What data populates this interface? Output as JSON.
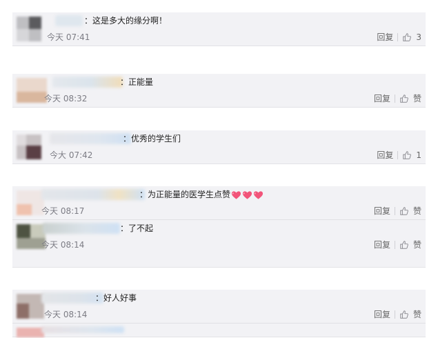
{
  "comments": [
    {
      "rows": [
        {
          "text": "：这是多大的缘分啊！",
          "time": "今天 07:41",
          "reply": "回复",
          "like": "3",
          "hearts": 0
        }
      ]
    },
    {
      "rows": [
        {
          "text": "：正能量",
          "time": "今天 08:32",
          "reply": "回复",
          "like": "赞",
          "hearts": 0
        }
      ]
    },
    {
      "rows": [
        {
          "text": "：优秀的学生们",
          "time": "今大 07:42",
          "reply": "回复",
          "like": "1",
          "hearts": 0
        }
      ]
    },
    {
      "rows": [
        {
          "text": "：为正能量的医学生点赞",
          "time": "今天 08:17",
          "reply": "回复",
          "like": "赞",
          "hearts": 3
        },
        {
          "text": "：了不起",
          "time": "今天 08:14",
          "reply": "回复",
          "like": "赞",
          "hearts": 0
        }
      ]
    },
    {
      "rows": [
        {
          "text": "：好人好事",
          "time": "今天 08:14",
          "reply": "回复",
          "like": "赞",
          "hearts": 0
        }
      ]
    }
  ],
  "icons": {
    "like": "thumbs-up-icon",
    "heart": "heart-emoji-icon"
  },
  "colors": {
    "card_bg": "#f2f2f5",
    "heart": "#f2557a"
  }
}
